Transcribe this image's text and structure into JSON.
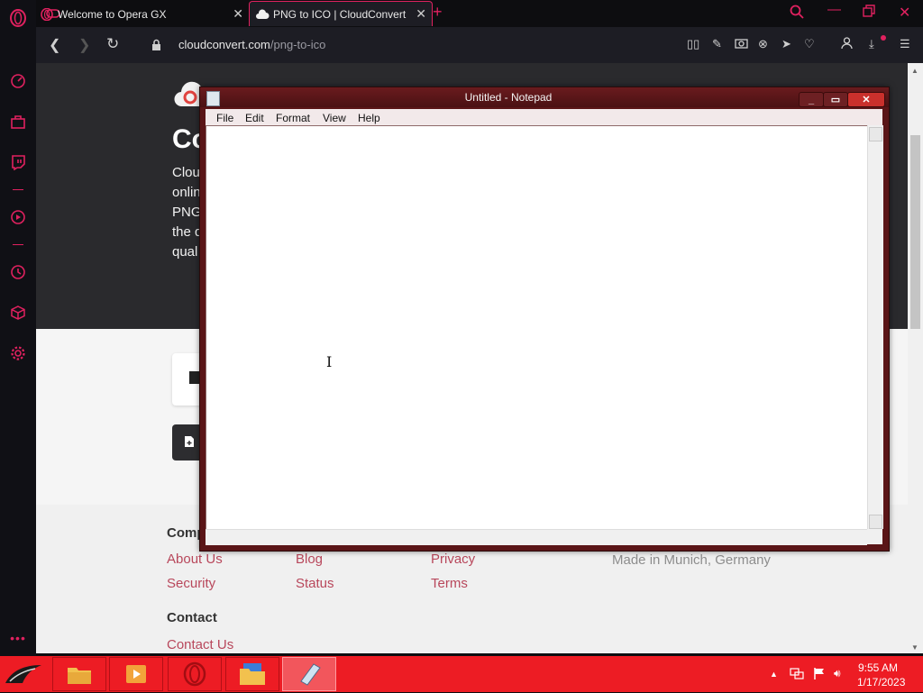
{
  "browser": {
    "tabs": [
      {
        "label": "Welcome to Opera GX",
        "active": false
      },
      {
        "label": "PNG to ICO | CloudConvert",
        "active": true
      }
    ],
    "url_host": "cloudconvert.com",
    "url_path": "/png-to-ico",
    "accent_color": "#e0215f"
  },
  "page": {
    "hero_title": "Co",
    "hero_lines": [
      "Clou",
      "onlin",
      "PNG",
      "the d",
      "qual"
    ],
    "footer": {
      "company_heading": "Comp",
      "col1": [
        "About Us",
        "Security"
      ],
      "col2": [
        "Blog",
        "Status"
      ],
      "col3": [
        "Privacy",
        "Terms"
      ],
      "note": "Made in Munich, Germany",
      "contact_heading": "Contact",
      "contact_link": "Contact Us"
    }
  },
  "notepad": {
    "title": "Untitled - Notepad",
    "menu": [
      "File",
      "Edit",
      "Format",
      "View",
      "Help"
    ],
    "content": ""
  },
  "taskbar": {
    "time": "9:55 AM",
    "date": "1/17/2023",
    "color": "#ed1c24"
  }
}
